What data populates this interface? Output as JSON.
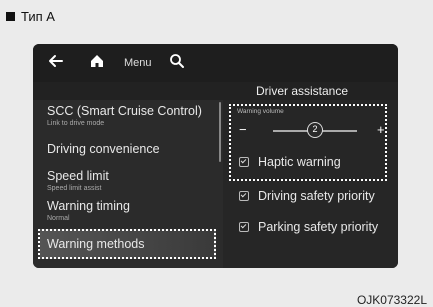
{
  "header": {
    "type_label": "Тип А"
  },
  "topbar": {
    "back_icon": "back-arrow-icon",
    "home_icon": "home-icon",
    "menu_label": "Menu",
    "search_icon": "search-icon"
  },
  "panel": {
    "title": "Driver assistance"
  },
  "left_menu": {
    "items": [
      {
        "label": "SCC (Smart Cruise Control)",
        "sub": "Link to drive mode"
      },
      {
        "label": "Driving convenience",
        "sub": ""
      },
      {
        "label": "Speed limit",
        "sub": "Speed limit assist"
      },
      {
        "label": "Warning timing",
        "sub": "Normal"
      },
      {
        "label": "Warning methods",
        "sub": ""
      }
    ]
  },
  "warning_volume": {
    "label": "Warning volume",
    "minus": "−",
    "plus": "+",
    "value": "2",
    "level_fraction": 0.5
  },
  "options": [
    {
      "label": "Haptic warning",
      "checked": true
    },
    {
      "label": "Driving safety priority",
      "checked": true
    },
    {
      "label": "Parking safety priority",
      "checked": true
    }
  ],
  "footer": {
    "code": "OJK073322L"
  },
  "colors": {
    "screen_bg": "#222222",
    "highlight": "#ffffff"
  }
}
